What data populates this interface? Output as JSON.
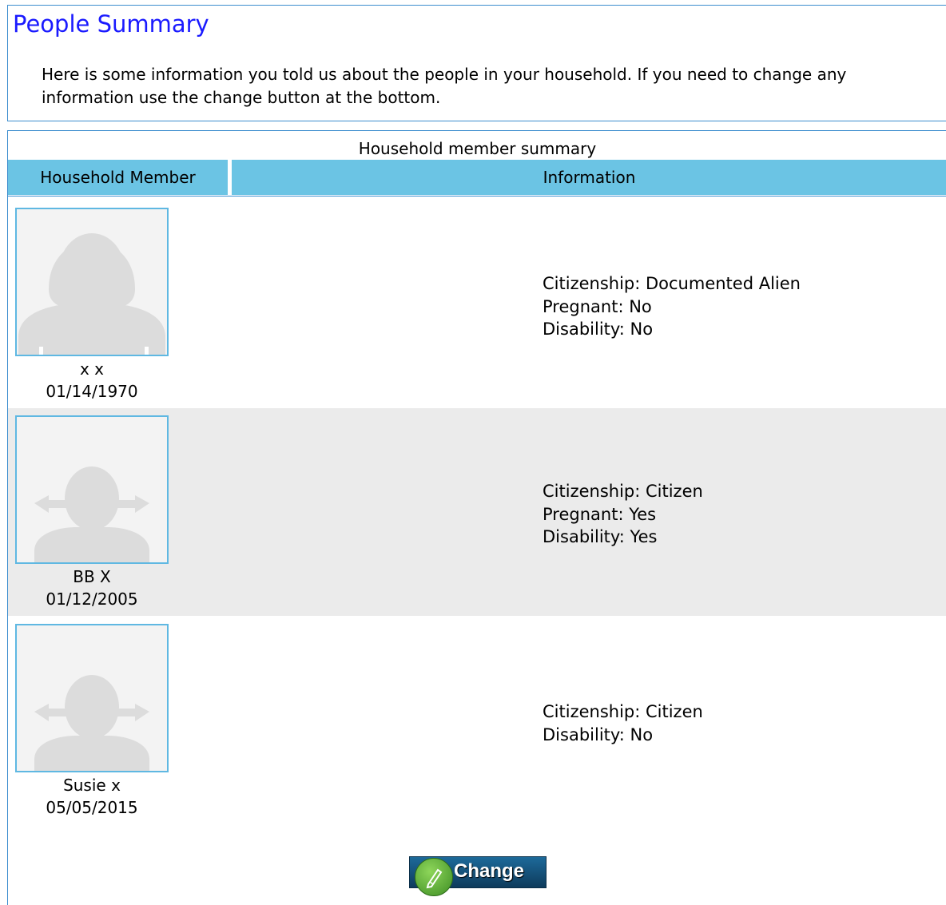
{
  "page": {
    "title": "People Summary",
    "intro": "Here is some information you told us about the people in your household. If you need to change any information use the change button at the bottom."
  },
  "table": {
    "caption": "Household member summary",
    "headers": {
      "member": "Household Member",
      "information": "Information"
    },
    "members": [
      {
        "avatar_icon": "adult-female-silhouette-icon",
        "name": "x x",
        "dob": "01/14/1970",
        "info": [
          "Citizenship: Documented Alien",
          "Pregnant: No",
          "Disability: No"
        ]
      },
      {
        "avatar_icon": "girl-pigtails-silhouette-icon",
        "name": "BB X",
        "dob": "01/12/2005",
        "info": [
          "Citizenship: Citizen",
          "Pregnant: Yes",
          "Disability: Yes"
        ]
      },
      {
        "avatar_icon": "girl-pigtails-silhouette-icon",
        "name": "Susie x",
        "dob": "05/05/2015",
        "info": [
          "Citizenship: Citizen",
          "Disability: No"
        ]
      }
    ]
  },
  "actions": {
    "change_label": "Change",
    "change_icon": "pencil-icon"
  },
  "colors": {
    "title": "#1a1aff",
    "header_bg": "#6bc4e4",
    "border": "#3c8dce",
    "row_shade": "#ebebeb"
  }
}
